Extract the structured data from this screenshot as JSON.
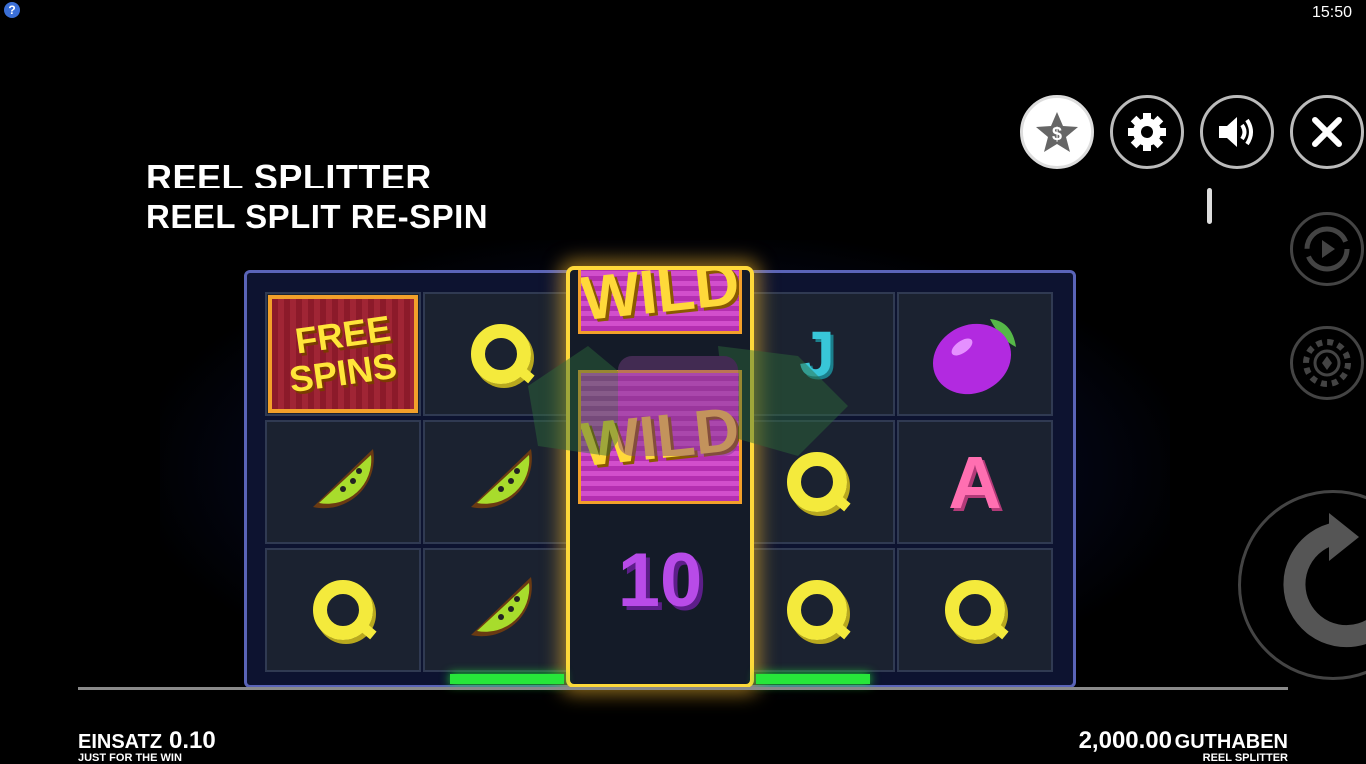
{
  "top_bar": {
    "help_label": "?",
    "time": "15:50"
  },
  "title": {
    "main": "REEL SPLITTER",
    "sub": "REEL SPLIT RE-SPIN"
  },
  "controls": {
    "cash_icon": "dollar-star-icon",
    "settings_icon": "gear-icon",
    "sound_icon": "speaker-icon",
    "close_icon": "close-icon",
    "autoplay_icon": "autoplay-icon",
    "bet_icon": "chip-icon",
    "spin_icon": "spin-arrow-icon"
  },
  "reels": {
    "symbols": [
      [
        "FREE SPINS",
        "Q",
        "WILD",
        "J",
        "plum"
      ],
      [
        "kiwi",
        "kiwi",
        "WILD",
        "Q",
        "A"
      ],
      [
        "Q",
        "kiwi",
        "10",
        "Q",
        "Q"
      ]
    ],
    "free_spins": {
      "line1": "FREE",
      "line2": "SPINS"
    },
    "wild_label": "WILD",
    "ten_label": "10"
  },
  "footer": {
    "stake_label": "EINSATZ",
    "stake_value": "0.10",
    "brand": "JUST FOR THE WIN",
    "balance_value": "2,000.00",
    "balance_label": "GUTHABEN",
    "game_name": "REEL SPLITTER"
  },
  "colors": {
    "background": "#000000",
    "frame": "#5a64b8",
    "wild_glow": "#ffd93a",
    "q_yellow": "#f4ea3c",
    "j_cyan": "#38c6d8",
    "a_pink": "#ff6fb1",
    "ten_purple": "#b84be8",
    "win_green": "#27e63a"
  }
}
